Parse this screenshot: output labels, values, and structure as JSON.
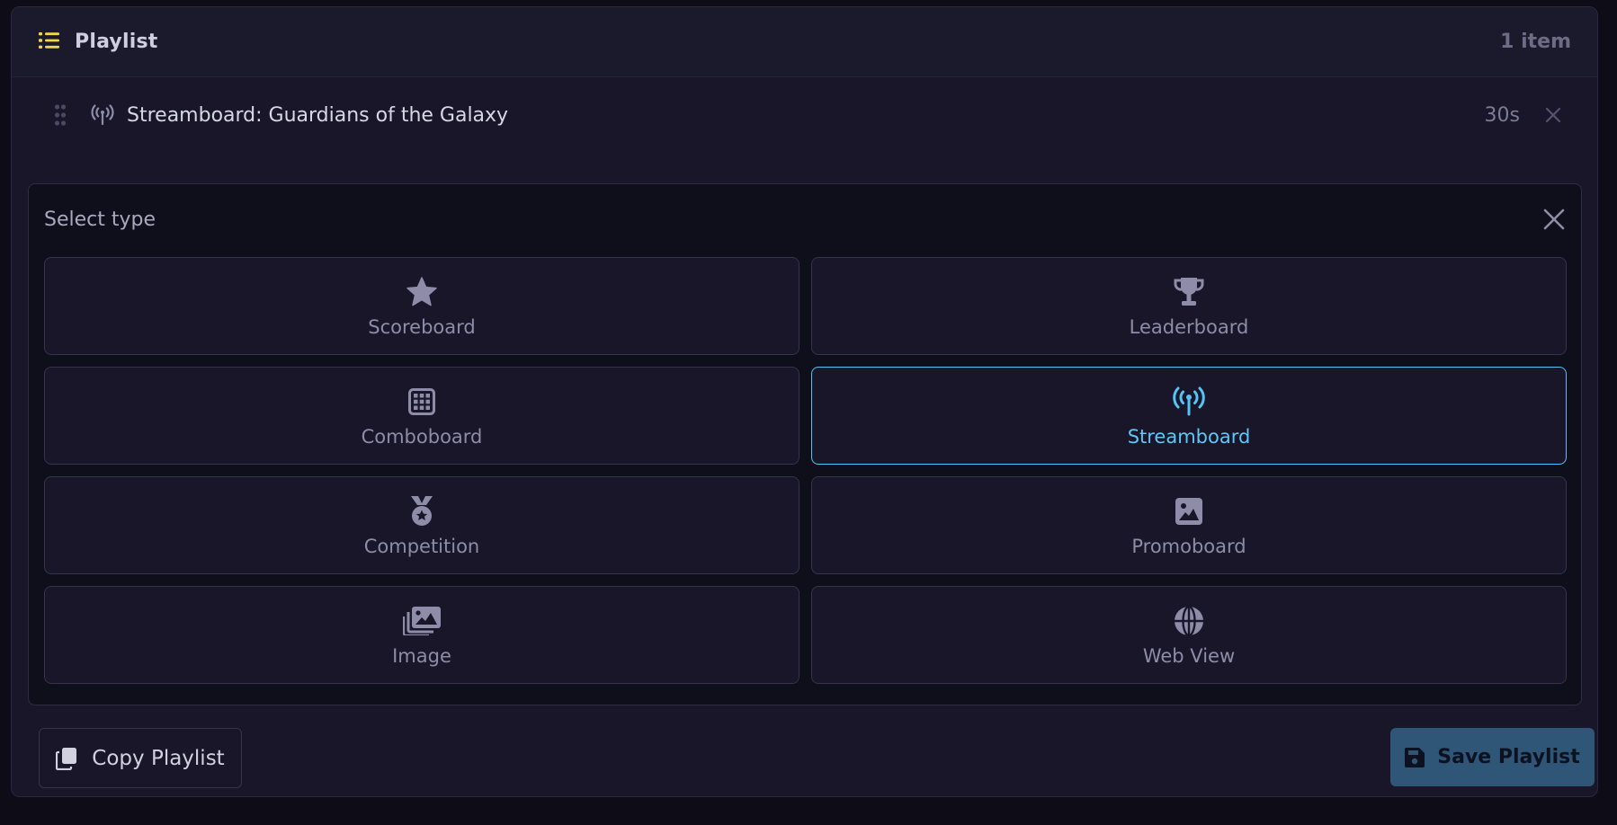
{
  "header": {
    "title": "Playlist",
    "icon": "list-icon",
    "count": "1 item"
  },
  "playlist": {
    "items": [
      {
        "title": "Streamboard: Guardians of the Galaxy",
        "type_icon": "broadcast-icon",
        "duration": "30s"
      }
    ]
  },
  "type_selector": {
    "title": "Select type",
    "options": [
      {
        "label": "Scoreboard",
        "icon": "star-icon",
        "selected": false
      },
      {
        "label": "Leaderboard",
        "icon": "trophy-icon",
        "selected": false
      },
      {
        "label": "Comboboard",
        "icon": "grid-icon",
        "selected": false
      },
      {
        "label": "Streamboard",
        "icon": "broadcast-icon",
        "selected": true
      },
      {
        "label": "Competition",
        "icon": "medal-icon",
        "selected": false
      },
      {
        "label": "Promoboard",
        "icon": "image-icon",
        "selected": false
      },
      {
        "label": "Image",
        "icon": "images-icon",
        "selected": false
      },
      {
        "label": "Web View",
        "icon": "globe-icon",
        "selected": false
      }
    ]
  },
  "footer": {
    "copy_label": "Copy Playlist",
    "save_label": "Save Playlist"
  },
  "colors": {
    "accent_yellow": "#f5d547",
    "selected_blue": "#55c4f4",
    "save_button": "#2f5577"
  }
}
